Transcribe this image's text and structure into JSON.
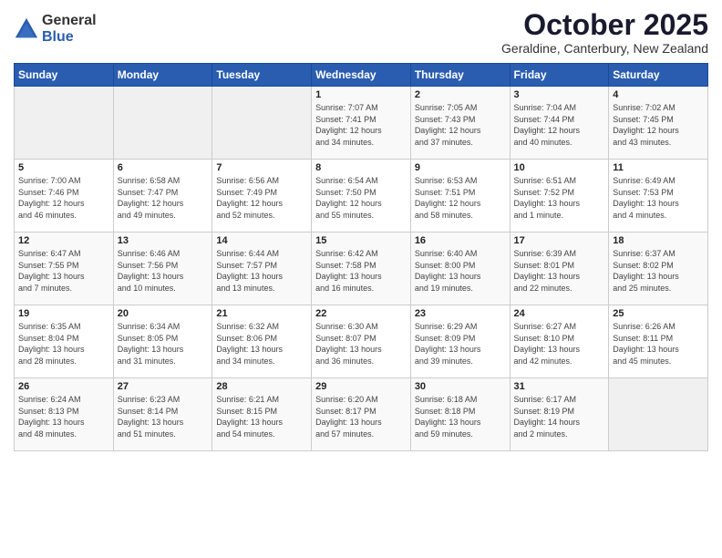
{
  "logo": {
    "general": "General",
    "blue": "Blue"
  },
  "header": {
    "month": "October 2025",
    "location": "Geraldine, Canterbury, New Zealand"
  },
  "weekdays": [
    "Sunday",
    "Monday",
    "Tuesday",
    "Wednesday",
    "Thursday",
    "Friday",
    "Saturday"
  ],
  "weeks": [
    [
      {
        "day": "",
        "info": ""
      },
      {
        "day": "",
        "info": ""
      },
      {
        "day": "",
        "info": ""
      },
      {
        "day": "1",
        "info": "Sunrise: 7:07 AM\nSunset: 7:41 PM\nDaylight: 12 hours\nand 34 minutes."
      },
      {
        "day": "2",
        "info": "Sunrise: 7:05 AM\nSunset: 7:43 PM\nDaylight: 12 hours\nand 37 minutes."
      },
      {
        "day": "3",
        "info": "Sunrise: 7:04 AM\nSunset: 7:44 PM\nDaylight: 12 hours\nand 40 minutes."
      },
      {
        "day": "4",
        "info": "Sunrise: 7:02 AM\nSunset: 7:45 PM\nDaylight: 12 hours\nand 43 minutes."
      }
    ],
    [
      {
        "day": "5",
        "info": "Sunrise: 7:00 AM\nSunset: 7:46 PM\nDaylight: 12 hours\nand 46 minutes."
      },
      {
        "day": "6",
        "info": "Sunrise: 6:58 AM\nSunset: 7:47 PM\nDaylight: 12 hours\nand 49 minutes."
      },
      {
        "day": "7",
        "info": "Sunrise: 6:56 AM\nSunset: 7:49 PM\nDaylight: 12 hours\nand 52 minutes."
      },
      {
        "day": "8",
        "info": "Sunrise: 6:54 AM\nSunset: 7:50 PM\nDaylight: 12 hours\nand 55 minutes."
      },
      {
        "day": "9",
        "info": "Sunrise: 6:53 AM\nSunset: 7:51 PM\nDaylight: 12 hours\nand 58 minutes."
      },
      {
        "day": "10",
        "info": "Sunrise: 6:51 AM\nSunset: 7:52 PM\nDaylight: 13 hours\nand 1 minute."
      },
      {
        "day": "11",
        "info": "Sunrise: 6:49 AM\nSunset: 7:53 PM\nDaylight: 13 hours\nand 4 minutes."
      }
    ],
    [
      {
        "day": "12",
        "info": "Sunrise: 6:47 AM\nSunset: 7:55 PM\nDaylight: 13 hours\nand 7 minutes."
      },
      {
        "day": "13",
        "info": "Sunrise: 6:46 AM\nSunset: 7:56 PM\nDaylight: 13 hours\nand 10 minutes."
      },
      {
        "day": "14",
        "info": "Sunrise: 6:44 AM\nSunset: 7:57 PM\nDaylight: 13 hours\nand 13 minutes."
      },
      {
        "day": "15",
        "info": "Sunrise: 6:42 AM\nSunset: 7:58 PM\nDaylight: 13 hours\nand 16 minutes."
      },
      {
        "day": "16",
        "info": "Sunrise: 6:40 AM\nSunset: 8:00 PM\nDaylight: 13 hours\nand 19 minutes."
      },
      {
        "day": "17",
        "info": "Sunrise: 6:39 AM\nSunset: 8:01 PM\nDaylight: 13 hours\nand 22 minutes."
      },
      {
        "day": "18",
        "info": "Sunrise: 6:37 AM\nSunset: 8:02 PM\nDaylight: 13 hours\nand 25 minutes."
      }
    ],
    [
      {
        "day": "19",
        "info": "Sunrise: 6:35 AM\nSunset: 8:04 PM\nDaylight: 13 hours\nand 28 minutes."
      },
      {
        "day": "20",
        "info": "Sunrise: 6:34 AM\nSunset: 8:05 PM\nDaylight: 13 hours\nand 31 minutes."
      },
      {
        "day": "21",
        "info": "Sunrise: 6:32 AM\nSunset: 8:06 PM\nDaylight: 13 hours\nand 34 minutes."
      },
      {
        "day": "22",
        "info": "Sunrise: 6:30 AM\nSunset: 8:07 PM\nDaylight: 13 hours\nand 36 minutes."
      },
      {
        "day": "23",
        "info": "Sunrise: 6:29 AM\nSunset: 8:09 PM\nDaylight: 13 hours\nand 39 minutes."
      },
      {
        "day": "24",
        "info": "Sunrise: 6:27 AM\nSunset: 8:10 PM\nDaylight: 13 hours\nand 42 minutes."
      },
      {
        "day": "25",
        "info": "Sunrise: 6:26 AM\nSunset: 8:11 PM\nDaylight: 13 hours\nand 45 minutes."
      }
    ],
    [
      {
        "day": "26",
        "info": "Sunrise: 6:24 AM\nSunset: 8:13 PM\nDaylight: 13 hours\nand 48 minutes."
      },
      {
        "day": "27",
        "info": "Sunrise: 6:23 AM\nSunset: 8:14 PM\nDaylight: 13 hours\nand 51 minutes."
      },
      {
        "day": "28",
        "info": "Sunrise: 6:21 AM\nSunset: 8:15 PM\nDaylight: 13 hours\nand 54 minutes."
      },
      {
        "day": "29",
        "info": "Sunrise: 6:20 AM\nSunset: 8:17 PM\nDaylight: 13 hours\nand 57 minutes."
      },
      {
        "day": "30",
        "info": "Sunrise: 6:18 AM\nSunset: 8:18 PM\nDaylight: 13 hours\nand 59 minutes."
      },
      {
        "day": "31",
        "info": "Sunrise: 6:17 AM\nSunset: 8:19 PM\nDaylight: 14 hours\nand 2 minutes."
      },
      {
        "day": "",
        "info": ""
      }
    ]
  ]
}
